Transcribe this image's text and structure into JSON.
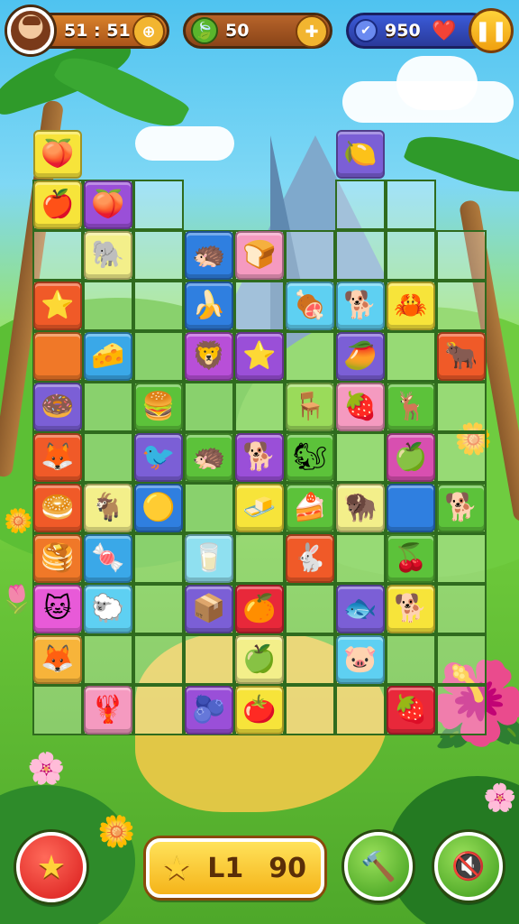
{
  "hud": {
    "timer_text": "51 : 51",
    "leaf_count": "50",
    "score": "950"
  },
  "bottom": {
    "level_label": "L1",
    "level_value": "90"
  },
  "tiles": [
    {
      "col": 0,
      "row": 0,
      "color": "#f7e43a",
      "icon": "🍑",
      "name": "peach-tile"
    },
    {
      "col": 6,
      "row": 0,
      "color": "#7b5fd6",
      "icon": "🍋",
      "name": "lemon-tile"
    },
    {
      "col": 0,
      "row": 1,
      "color": "#f7e43a",
      "icon": "🍎",
      "name": "apple-tile"
    },
    {
      "col": 1,
      "row": 1,
      "color": "#9a4fd8",
      "icon": "🍑",
      "name": "plum-tile"
    },
    {
      "col": 1,
      "row": 2,
      "color": "#f3ef8a",
      "icon": "🐘",
      "name": "elephant-tile"
    },
    {
      "col": 3,
      "row": 2,
      "color": "#2f7fe0",
      "icon": "🦔",
      "name": "hedgehog-tile"
    },
    {
      "col": 4,
      "row": 2,
      "color": "#f59ac0",
      "icon": "🍞",
      "name": "toast-tile"
    },
    {
      "col": 0,
      "row": 3,
      "color": "#f05a28",
      "icon": "⭐",
      "name": "star-tile"
    },
    {
      "col": 3,
      "row": 3,
      "color": "#2f7fe0",
      "icon": "🍌",
      "name": "banana-tile"
    },
    {
      "col": 5,
      "row": 3,
      "color": "#5ed0f2",
      "icon": "🍖",
      "name": "meat-tile"
    },
    {
      "col": 6,
      "row": 3,
      "color": "#5ed0f2",
      "icon": "🐕",
      "name": "dog-tile"
    },
    {
      "col": 7,
      "row": 3,
      "color": "#f7e43a",
      "icon": "🦀",
      "name": "crab-tile"
    },
    {
      "col": 0,
      "row": 4,
      "color": "#f07828",
      "icon": "",
      "name": "orange-tile"
    },
    {
      "col": 1,
      "row": 4,
      "color": "#3aa8e8",
      "icon": "🧀",
      "name": "cheese-tile"
    },
    {
      "col": 3,
      "row": 4,
      "color": "#b84fd8",
      "icon": "🦁",
      "name": "lion-tile"
    },
    {
      "col": 4,
      "row": 4,
      "color": "#9a4fd8",
      "icon": "⭐",
      "name": "starfish-tile"
    },
    {
      "col": 6,
      "row": 4,
      "color": "#7b5fd6",
      "icon": "🥭",
      "name": "mango-tile"
    },
    {
      "col": 8,
      "row": 4,
      "color": "#f05a28",
      "icon": "🐂",
      "name": "ox-tile"
    },
    {
      "col": 0,
      "row": 5,
      "color": "#7b5fd6",
      "icon": "🍩",
      "name": "donut-tile"
    },
    {
      "col": 2,
      "row": 5,
      "color": "#5cc23a",
      "icon": "🍔",
      "name": "burger-tile"
    },
    {
      "col": 5,
      "row": 5,
      "color": "#9adb5a",
      "icon": "🪑",
      "name": "stool-tile"
    },
    {
      "col": 6,
      "row": 5,
      "color": "#f59ac0",
      "icon": "🍓",
      "name": "berry-tile"
    },
    {
      "col": 7,
      "row": 5,
      "color": "#5cc23a",
      "icon": "🦌",
      "name": "deer-tile"
    },
    {
      "col": 0,
      "row": 6,
      "color": "#f05a28",
      "icon": "🦊",
      "name": "fox-tile"
    },
    {
      "col": 2,
      "row": 6,
      "color": "#7b5fd6",
      "icon": "🐦",
      "name": "bird-tile"
    },
    {
      "col": 3,
      "row": 6,
      "color": "#5cc23a",
      "icon": "🦔",
      "name": "porcupine-tile"
    },
    {
      "col": 4,
      "row": 6,
      "color": "#9a4fd8",
      "icon": "🐕",
      "name": "puppy-tile"
    },
    {
      "col": 5,
      "row": 6,
      "color": "#5cc23a",
      "icon": "🐿",
      "name": "squirrel-tile"
    },
    {
      "col": 7,
      "row": 6,
      "color": "#d84fb0",
      "icon": "🍏",
      "name": "green-apple-tile"
    },
    {
      "col": 0,
      "row": 7,
      "color": "#f05a28",
      "icon": "🥯",
      "name": "bagel-tile"
    },
    {
      "col": 1,
      "row": 7,
      "color": "#f3ef8a",
      "icon": "🐐",
      "name": "goat-tile"
    },
    {
      "col": 2,
      "row": 7,
      "color": "#2f7fe0",
      "icon": "🟡",
      "name": "ball-tile"
    },
    {
      "col": 4,
      "row": 7,
      "color": "#f7e43a",
      "icon": "🧈",
      "name": "butter-tile"
    },
    {
      "col": 5,
      "row": 7,
      "color": "#5cc23a",
      "icon": "🍰",
      "name": "cake-tile"
    },
    {
      "col": 6,
      "row": 7,
      "color": "#f3ef8a",
      "icon": "🦬",
      "name": "bison-tile"
    },
    {
      "col": 7,
      "row": 7,
      "color": "#2f7fe0",
      "icon": "",
      "name": "blue-tile"
    },
    {
      "col": 8,
      "row": 7,
      "color": "#5cc23a",
      "icon": "🐕",
      "name": "hound-tile"
    },
    {
      "col": 0,
      "row": 8,
      "color": "#f07828",
      "icon": "🥞",
      "name": "pancake-tile"
    },
    {
      "col": 1,
      "row": 8,
      "color": "#3aa8e8",
      "icon": "🍬",
      "name": "candy-tile"
    },
    {
      "col": 3,
      "row": 8,
      "color": "#8fe0f0",
      "icon": "🥛",
      "name": "cup-tile"
    },
    {
      "col": 5,
      "row": 8,
      "color": "#f05a28",
      "icon": "🐇",
      "name": "rabbit-tile"
    },
    {
      "col": 7,
      "row": 8,
      "color": "#5cc23a",
      "icon": "🍒",
      "name": "cherry-tile"
    },
    {
      "col": 0,
      "row": 9,
      "color": "#e85ad8",
      "icon": "🐱",
      "name": "cat-tile"
    },
    {
      "col": 1,
      "row": 9,
      "color": "#5ed0f2",
      "icon": "🐑",
      "name": "sheep-tile"
    },
    {
      "col": 3,
      "row": 9,
      "color": "#7b5fd6",
      "icon": "📦",
      "name": "box-tile"
    },
    {
      "col": 4,
      "row": 9,
      "color": "#e8283a",
      "icon": "🍊",
      "name": "orange-fruit-tile"
    },
    {
      "col": 6,
      "row": 9,
      "color": "#7b5fd6",
      "icon": "🐟",
      "name": "fish-tile"
    },
    {
      "col": 7,
      "row": 9,
      "color": "#f7e43a",
      "icon": "🐕",
      "name": "shiba-tile"
    },
    {
      "col": 0,
      "row": 10,
      "color": "#f7b43a",
      "icon": "🦊",
      "name": "squirrel-face-tile"
    },
    {
      "col": 4,
      "row": 10,
      "color": "#f3ef8a",
      "icon": "🍏",
      "name": "lime-tile"
    },
    {
      "col": 6,
      "row": 10,
      "color": "#5ed0f2",
      "icon": "🐷",
      "name": "pig-tile"
    },
    {
      "col": 1,
      "row": 11,
      "color": "#f59ac0",
      "icon": "🦞",
      "name": "lobster-tile"
    },
    {
      "col": 3,
      "row": 11,
      "color": "#9a4fd8",
      "icon": "🫐",
      "name": "blueberry-tile"
    },
    {
      "col": 4,
      "row": 11,
      "color": "#f7e43a",
      "icon": "🍅",
      "name": "tomato-tile"
    },
    {
      "col": 7,
      "row": 11,
      "color": "#e8283a",
      "icon": "🍓",
      "name": "raspberry-tile"
    }
  ],
  "cells": [
    [
      0,
      1
    ],
    [
      1,
      1
    ],
    [
      2,
      1
    ],
    [
      0,
      2
    ],
    [
      1,
      2
    ],
    [
      2,
      2
    ],
    [
      3,
      2
    ],
    [
      4,
      2
    ],
    [
      5,
      2
    ],
    [
      6,
      2
    ],
    [
      7,
      2
    ],
    [
      8,
      2
    ],
    [
      0,
      3
    ],
    [
      1,
      3
    ],
    [
      2,
      3
    ],
    [
      3,
      3
    ],
    [
      4,
      3
    ],
    [
      5,
      3
    ],
    [
      6,
      3
    ],
    [
      7,
      3
    ],
    [
      8,
      3
    ],
    [
      0,
      4
    ],
    [
      1,
      4
    ],
    [
      2,
      4
    ],
    [
      3,
      4
    ],
    [
      4,
      4
    ],
    [
      5,
      4
    ],
    [
      6,
      4
    ],
    [
      7,
      4
    ],
    [
      8,
      4
    ],
    [
      0,
      5
    ],
    [
      1,
      5
    ],
    [
      2,
      5
    ],
    [
      3,
      5
    ],
    [
      4,
      5
    ],
    [
      5,
      5
    ],
    [
      6,
      5
    ],
    [
      7,
      5
    ],
    [
      8,
      5
    ],
    [
      0,
      6
    ],
    [
      1,
      6
    ],
    [
      2,
      6
    ],
    [
      3,
      6
    ],
    [
      4,
      6
    ],
    [
      5,
      6
    ],
    [
      6,
      6
    ],
    [
      7,
      6
    ],
    [
      8,
      6
    ],
    [
      0,
      7
    ],
    [
      1,
      7
    ],
    [
      2,
      7
    ],
    [
      3,
      7
    ],
    [
      4,
      7
    ],
    [
      5,
      7
    ],
    [
      6,
      7
    ],
    [
      7,
      7
    ],
    [
      8,
      7
    ],
    [
      0,
      8
    ],
    [
      1,
      8
    ],
    [
      2,
      8
    ],
    [
      3,
      8
    ],
    [
      4,
      8
    ],
    [
      5,
      8
    ],
    [
      6,
      8
    ],
    [
      7,
      8
    ],
    [
      8,
      8
    ],
    [
      0,
      9
    ],
    [
      1,
      9
    ],
    [
      2,
      9
    ],
    [
      3,
      9
    ],
    [
      4,
      9
    ],
    [
      5,
      9
    ],
    [
      6,
      9
    ],
    [
      7,
      9
    ],
    [
      8,
      9
    ],
    [
      0,
      10
    ],
    [
      1,
      10
    ],
    [
      2,
      10
    ],
    [
      3,
      10
    ],
    [
      4,
      10
    ],
    [
      5,
      10
    ],
    [
      6,
      10
    ],
    [
      7,
      10
    ],
    [
      8,
      10
    ],
    [
      0,
      11
    ],
    [
      1,
      11
    ],
    [
      2,
      11
    ],
    [
      3,
      11
    ],
    [
      4,
      11
    ],
    [
      5,
      11
    ],
    [
      6,
      11
    ],
    [
      7,
      11
    ],
    [
      8,
      11
    ],
    [
      6,
      1
    ],
    [
      7,
      1
    ],
    [
      7,
      2
    ],
    [
      8,
      2
    ]
  ]
}
